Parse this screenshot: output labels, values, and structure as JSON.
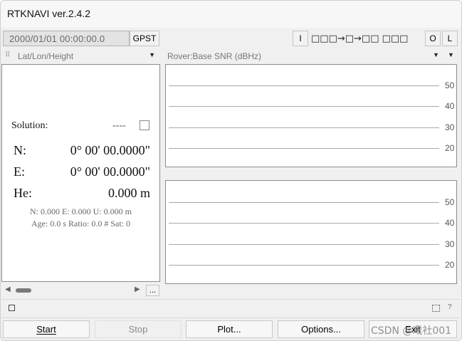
{
  "window": {
    "title": "RTKNAVI ver.2.4.2"
  },
  "toolbar": {
    "time": "2000/01/01 00:00:00.0",
    "time_system": "GPST",
    "input_label": "I",
    "stream_status": "□□□→□→□□ □□□",
    "output_label": "O",
    "log_label": "L"
  },
  "left_panel": {
    "mode_select": "Lat/Lon/Height",
    "solution_label": "Solution:",
    "solution_value": "----",
    "rows": [
      {
        "label": "N:",
        "value": "0° 00' 00.0000\""
      },
      {
        "label": "E:",
        "value": "0° 00' 00.0000\""
      },
      {
        "label": "He:",
        "value": "0.000 m"
      }
    ],
    "stats_line1": "N: 0.000 E: 0.000 U: 0.000 m",
    "stats_line2": "Age: 0.0 s Ratio: 0.0 # Sat: 0",
    "more_button": "..."
  },
  "right_panel": {
    "plot_select": "Rover:Base SNR (dBHz)",
    "y_ticks": [
      "50",
      "40",
      "30",
      "20"
    ]
  },
  "chart_data": [
    {
      "type": "bar",
      "title": "Rover:Base SNR (dBHz)",
      "ylabel": "",
      "xlabel": "",
      "yticks": [
        50,
        40,
        30,
        20
      ],
      "ylim": [
        10,
        60
      ],
      "categories": [],
      "values": []
    },
    {
      "type": "bar",
      "title": "",
      "ylabel": "",
      "xlabel": "",
      "yticks": [
        50,
        40,
        30,
        20
      ],
      "ylim": [
        10,
        60
      ],
      "categories": [],
      "values": []
    }
  ],
  "status_bar": {
    "help_label": "?"
  },
  "buttons": {
    "start": "Start",
    "stop": "Stop",
    "plot": "Plot...",
    "options": "Options...",
    "exit": "Exit"
  },
  "watermark": "CSDN @戏社001"
}
